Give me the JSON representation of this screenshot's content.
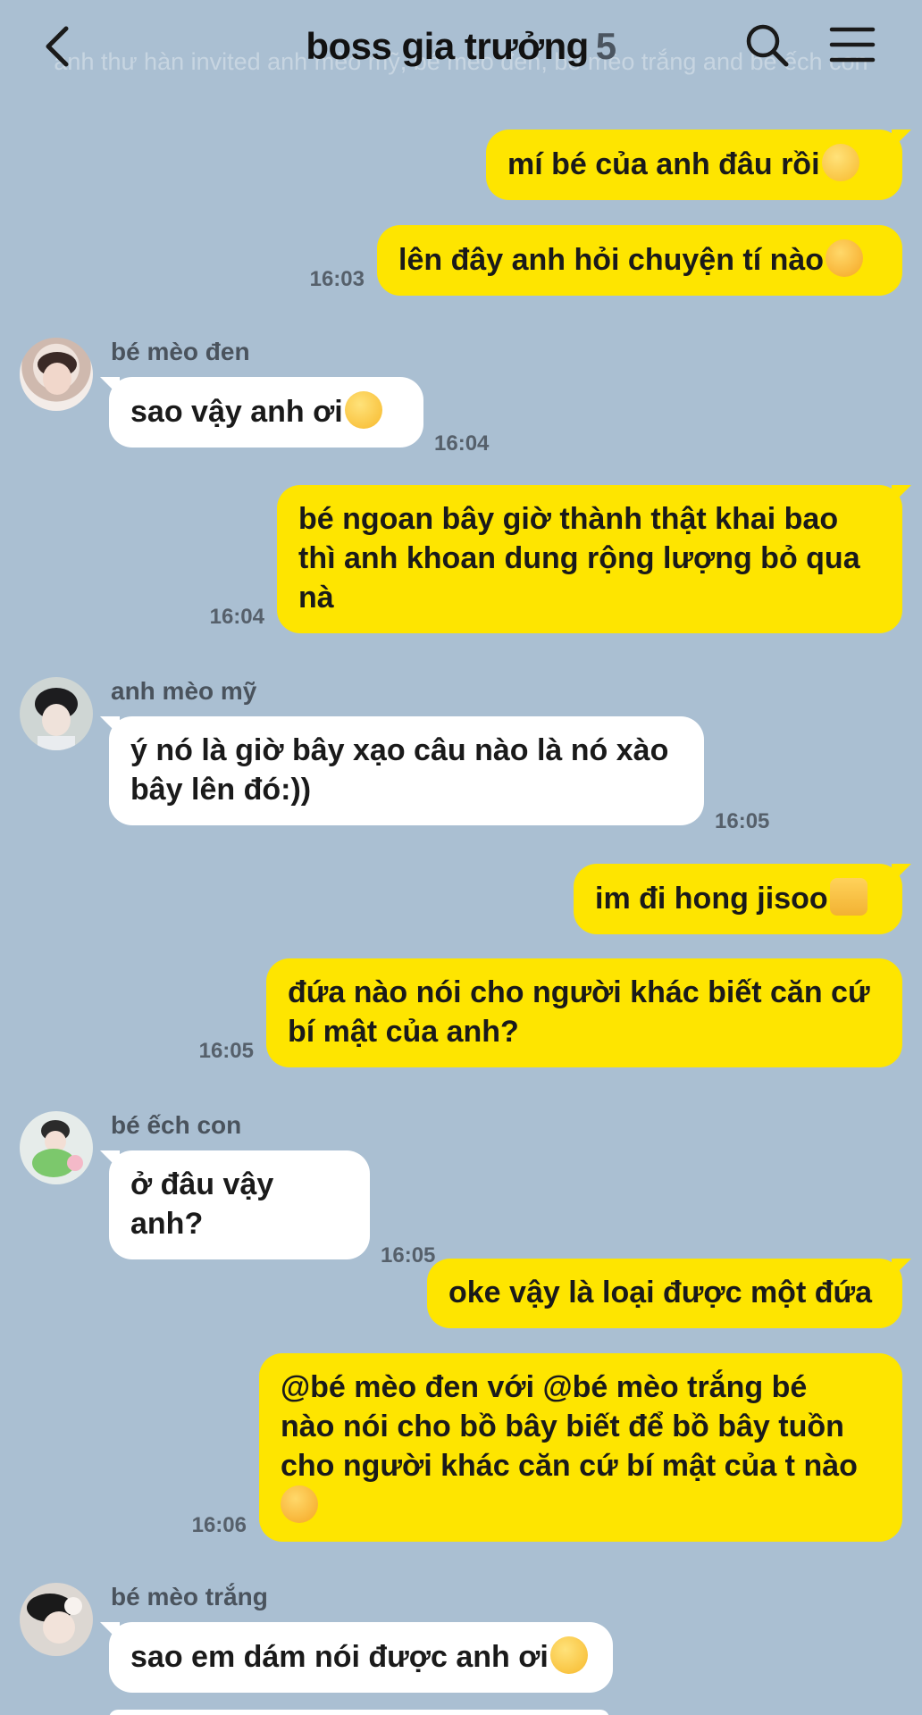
{
  "header": {
    "title": "boss gia trưởng",
    "member_count": "5",
    "ghost_notice": "anh thư hàn invited anh mèo mỹ, bé mèo đen, bé mèo trắng and bé ếch con"
  },
  "icons": {
    "back": "chevron-left-icon",
    "search": "search-icon",
    "menu": "hamburger-menu-icon"
  },
  "colors": {
    "background": "#aabfd2",
    "outgoing_bubble": "#fee500",
    "incoming_bubble": "#ffffff"
  },
  "messages": [
    {
      "from": "me",
      "text": "mí bé của anh đâu rồi☺️"
    },
    {
      "from": "me",
      "text": "lên đây anh hỏi chuyện tí nào🥰",
      "time": "16:03"
    },
    {
      "from": "bé mèo đen",
      "text": "sao vậy anh ơi🥹",
      "time": "16:04"
    },
    {
      "from": "me",
      "text": "bé ngoan bây giờ thành thật khai bao thì anh khoan dung rộng lượng bỏ qua nà",
      "time": "16:04"
    },
    {
      "from": "anh mèo mỹ",
      "text": "ý nó là giờ bây xạo câu nào là nó xào bây lên đó:))",
      "time": "16:05"
    },
    {
      "from": "me",
      "text": "im đi hong jisoo👍"
    },
    {
      "from": "me",
      "text": "đứa nào nói cho người khác biết căn cứ bí mật của anh?",
      "time": "16:05"
    },
    {
      "from": "bé ếch con",
      "text": "ở đâu vậy anh?",
      "time": "16:05"
    },
    {
      "from": "me",
      "text": "oke vậy là loại được một đứa"
    },
    {
      "from": "me",
      "text": "@bé mèo đen với @bé mèo trắng bé nào nói cho bồ bây biết để bồ bây tuồn cho người khác căn cứ bí mật của t nào🥰",
      "time": "16:06"
    },
    {
      "from": "bé mèo trắng",
      "text": "sao em dám nói được anh ơi🥲"
    }
  ],
  "ui": {
    "m0": "mí bé của anh đâu rồi",
    "m1": "lên đây anh hỏi chuyện tí nào",
    "t1": "16:03",
    "s2": "bé mèo đen",
    "m2": "sao vậy anh ơi",
    "t2": "16:04",
    "m3a": "bé ngoan bây giờ thành thật khai bao",
    "m3b": "thì anh khoan dung rộng lượng bỏ qua",
    "m3c": "nà",
    "t3": "16:04",
    "s4": "anh mèo mỹ",
    "m4a": "ý nó là giờ bây xạo câu nào là nó xào",
    "m4b": "bây lên đó:))",
    "t4": "16:05",
    "m5": "im đi hong jisoo",
    "m6a": "đứa nào nói cho người khác biết căn cứ",
    "m6b": "bí mật của anh?",
    "t6": "16:05",
    "s7": "bé ếch con",
    "m7": "ở đâu vậy anh?",
    "t7": "16:05",
    "m8": "oke vậy là loại được một đứa",
    "m9a": "@bé mèo đen với @bé mèo trắng bé",
    "m9b": "nào nói cho bồ bây biết để bồ bây tuồn",
    "m9c": "cho người khác căn cứ bí mật của t nào",
    "t9": "16:06",
    "s10": "bé mèo trắng",
    "m10": "sao em dám nói được anh ơi"
  }
}
